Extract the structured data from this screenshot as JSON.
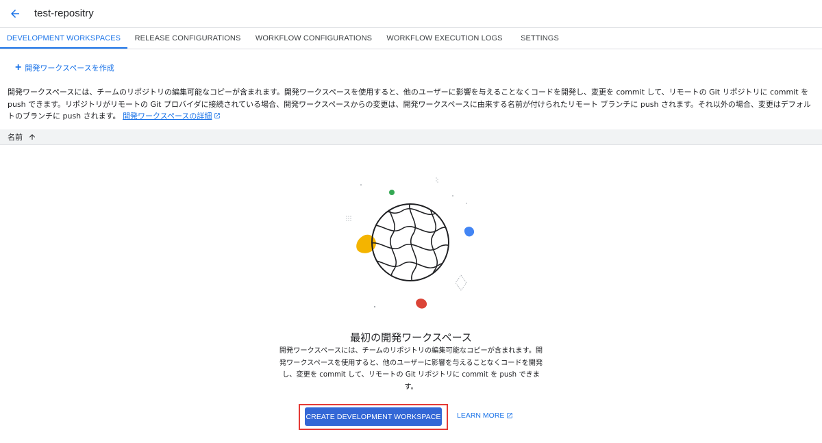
{
  "header": {
    "title": "test-repositry"
  },
  "tabs": [
    {
      "label": "DEVELOPMENT WORKSPACES",
      "active": true
    },
    {
      "label": "RELEASE CONFIGURATIONS",
      "active": false
    },
    {
      "label": "WORKFLOW CONFIGURATIONS",
      "active": false
    },
    {
      "label": "WORKFLOW EXECUTION LOGS",
      "active": false
    },
    {
      "label": "SETTINGS",
      "active": false
    }
  ],
  "toolbar": {
    "create_label": "開発ワークスペースを作成"
  },
  "description": {
    "text": "開発ワークスペースには、チームのリポジトリの編集可能なコピーが含まれます。開発ワークスペースを使用すると、他のユーザーに影響を与えることなくコードを開発し、変更を commit して、リモートの Git リポジトリに commit を push できます。リポジトリがリモートの Git プロバイダに接続されている場合、開発ワークスペースからの変更は、開発ワークスペースに由来する名前が付けられたリモート ブランチに push されます。それ以外の場合、変更はデフォルトのブランチに push されます。",
    "link_label": "開発ワークスペースの詳細"
  },
  "table": {
    "column_name": "名前",
    "sort": "ascending"
  },
  "empty_state": {
    "title": "最初の開発ワークスペース",
    "description": "開発ワークスペースには、チームのリポジトリの編集可能なコピーが含まれます。開発ワークスペースを使用すると、他のユーザーに影響を与えることなくコードを開発し、変更を commit して、リモートの Git リポジトリに commit を push できます。",
    "create_button": "CREATE DEVELOPMENT WORKSPACE",
    "learn_more": "LEARN MORE"
  },
  "icons": {
    "back": "arrow-back-icon",
    "add": "plus-icon",
    "external": "open-in-new-icon",
    "sort": "arrow-up-icon"
  },
  "colors": {
    "accent": "#1a73e8",
    "button": "#3367d6",
    "highlight": "#e53935",
    "yellow": "#f4b400",
    "blue": "#4285f4",
    "red": "#db4437",
    "green": "#34a853"
  }
}
